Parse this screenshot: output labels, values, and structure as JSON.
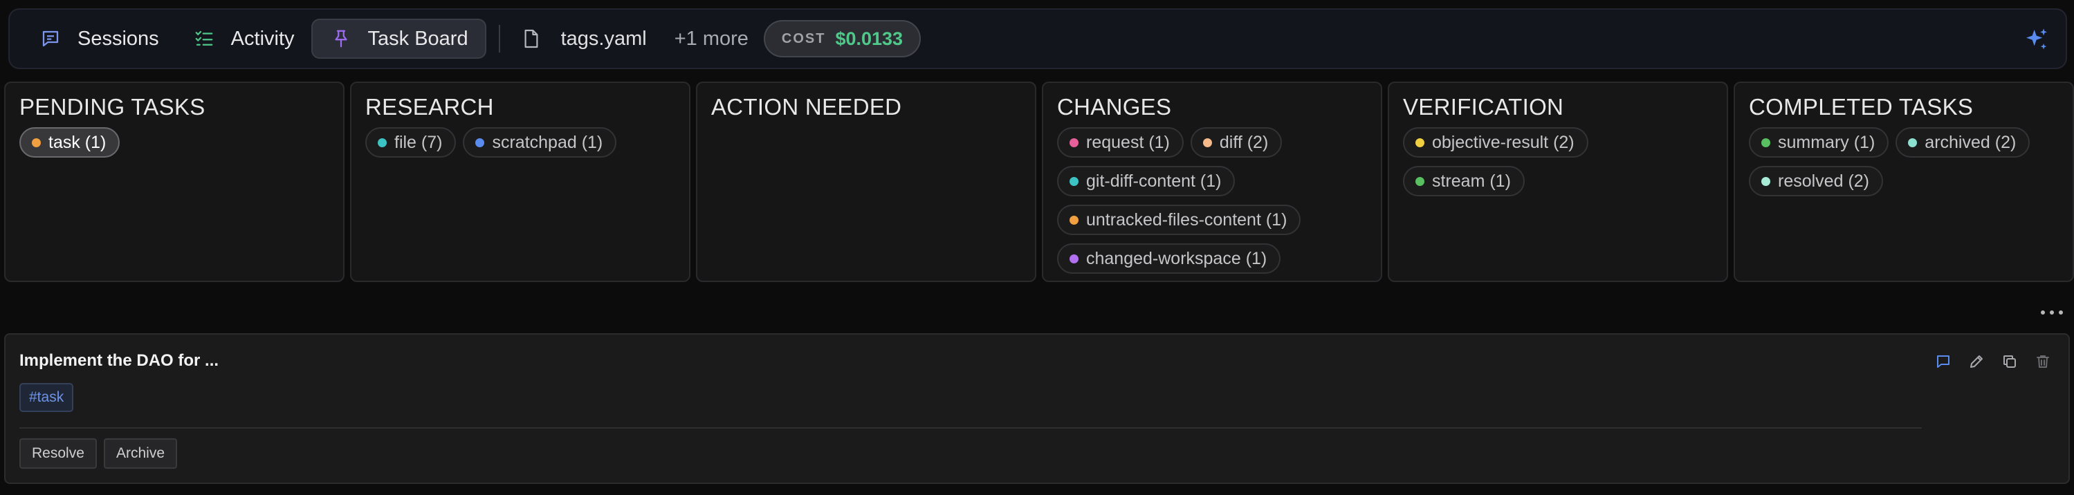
{
  "topbar": {
    "tabs": [
      {
        "label": "Sessions",
        "icon": "chat-bubble-icon",
        "active": false
      },
      {
        "label": "Activity",
        "icon": "checklist-icon",
        "active": false
      },
      {
        "label": "Task Board",
        "icon": "pin-icon",
        "active": true
      }
    ],
    "file_tab": {
      "label": "tags.yaml",
      "icon": "file-icon"
    },
    "more_label": "+1 more",
    "cost": {
      "label": "COST",
      "value": "$0.0133"
    },
    "assistant_icon": "sparkle-icon"
  },
  "columns": [
    {
      "title": "PENDING TASKS",
      "chips": [
        {
          "label": "task (1)",
          "color": "#f0a040",
          "selected": true
        }
      ]
    },
    {
      "title": "RESEARCH",
      "chips": [
        {
          "label": "file (7)",
          "color": "#3cc4c4"
        },
        {
          "label": "scratchpad (1)",
          "color": "#5a8cf0"
        }
      ]
    },
    {
      "title": "ACTION NEEDED",
      "chips": []
    },
    {
      "title": "CHANGES",
      "chips": [
        {
          "label": "request (1)",
          "color": "#e8609a"
        },
        {
          "label": "diff (2)",
          "color": "#f5b98a"
        },
        {
          "label": "git-diff-content (1)",
          "color": "#3cc4c4"
        },
        {
          "label": "untracked-files-content (1)",
          "color": "#f0a040"
        },
        {
          "label": "changed-workspace (1)",
          "color": "#b070f0"
        }
      ]
    },
    {
      "title": "VERIFICATION",
      "chips": [
        {
          "label": "objective-result (2)",
          "color": "#f0d040"
        },
        {
          "label": "stream (1)",
          "color": "#58c060"
        }
      ]
    },
    {
      "title": "COMPLETED TASKS",
      "chips": [
        {
          "label": "summary (1)",
          "color": "#58c060"
        },
        {
          "label": "archived (2)",
          "color": "#8ce0d0"
        },
        {
          "label": "resolved (2)",
          "color": "#a8ecd8"
        }
      ]
    }
  ],
  "task_card": {
    "title": "Implement the DAO for ...",
    "tag": "#task",
    "resolve_label": "Resolve",
    "archive_label": "Archive"
  },
  "colors": {
    "accent_blue": "#5a8cf0",
    "cost_green": "#4fc98a",
    "pin_purple": "#9d6cf0",
    "check_green": "#4fc98a"
  }
}
